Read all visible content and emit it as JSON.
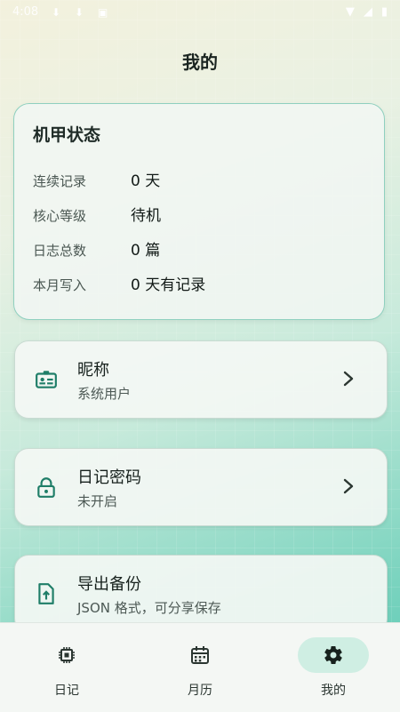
{
  "status_bar": {
    "time": "4:08"
  },
  "page": {
    "title": "我的"
  },
  "status_card": {
    "title": "机甲状态",
    "rows": [
      {
        "label": "连续记录",
        "value": "0 天"
      },
      {
        "label": "核心等级",
        "value": "待机"
      },
      {
        "label": "日志总数",
        "value": "0 篇"
      },
      {
        "label": "本月写入",
        "value": "0 天有记录"
      }
    ]
  },
  "settings": [
    {
      "title": "昵称",
      "subtitle": "系统用户",
      "icon": "id-card-icon"
    },
    {
      "title": "日记密码",
      "subtitle": "未开启",
      "icon": "lock-icon"
    },
    {
      "title": "导出备份",
      "subtitle": "JSON 格式，可分享保存",
      "icon": "upload-file-icon"
    }
  ],
  "nav": {
    "items": [
      {
        "label": "日记",
        "icon": "chip-icon"
      },
      {
        "label": "月历",
        "icon": "calendar-icon"
      },
      {
        "label": "我的",
        "icon": "gear-icon",
        "active": true
      }
    ]
  },
  "colors": {
    "accent": "#1f7e68",
    "active_pill": "#cfeee3",
    "card_border": "#8fd0bf"
  }
}
